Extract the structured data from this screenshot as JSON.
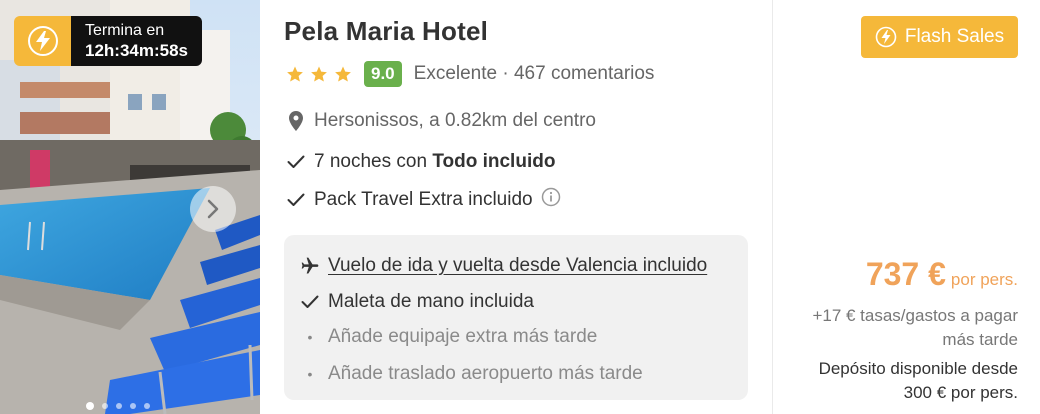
{
  "hotel": {
    "name": "Pela Maria Hotel",
    "stars": 3,
    "score": "9.0",
    "rating_text": "Excelente · 467 comentarios",
    "location": "Hersonissos, a 0.82km del centro",
    "nights_prefix": "7 noches con",
    "nights_bold": "Todo incluido",
    "pack": "Pack Travel Extra incluido"
  },
  "timer": {
    "label": "Termina en",
    "value": "12h:34m:58s"
  },
  "carousel": {
    "dot_count": 5,
    "active_index": 0
  },
  "flight": {
    "line1": "Vuelo de ida y vuelta desde Valencia incluido",
    "line2": "Maleta de mano incluida",
    "line3": "Añade equipaje extra más tarde",
    "line4": "Añade traslado aeropuerto más tarde"
  },
  "pricing": {
    "badge": "Flash Sales",
    "price": "737 €",
    "per": "por pers.",
    "fees": "+17 € tasas/gastos a pagar más tarde",
    "deposit": "Depósito disponible desde 300 € por pers."
  },
  "colors": {
    "accent": "#f5b83a",
    "price": "#f0a35a",
    "score_bg": "#6ab04c",
    "box_bg": "#f1f1f1"
  },
  "icons": {
    "timer": "lightning-icon",
    "next": "chevron-right-icon",
    "location": "map-pin-icon",
    "check": "check-icon",
    "info": "info-circle-icon",
    "plane": "plane-icon"
  }
}
